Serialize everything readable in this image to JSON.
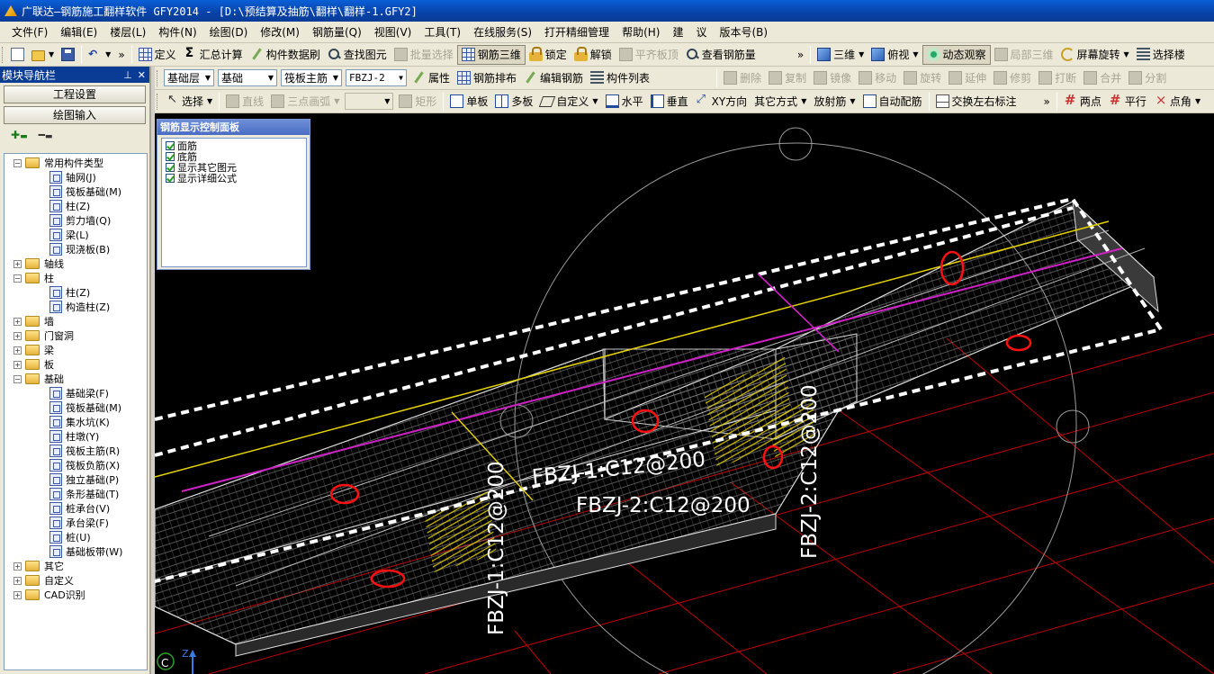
{
  "window": {
    "title": "广联达—钢筋施工翻样软件 GFY2014 - [D:\\预结算及抽筋\\翻样\\翻样-1.GFY2]"
  },
  "menu": [
    "文件(F)",
    "编辑(E)",
    "楼层(L)",
    "构件(N)",
    "绘图(D)",
    "修改(M)",
    "钢筋量(Q)",
    "视图(V)",
    "工具(T)",
    "在线服务(S)",
    "打开精细管理",
    "帮助(H)",
    "建",
    "议",
    "版本号(B)"
  ],
  "toolbar1": {
    "define": "定义",
    "summary": "汇总计算",
    "brush": "构件数据刷",
    "find": "查找图元",
    "batch_select": "批量选择",
    "rebar3d": "钢筋三维",
    "lock": "锁定",
    "unlock": "解锁",
    "flat_top": "平齐板顶",
    "view_qty": "查看钢筋量",
    "view3d": "三维",
    "top_view": "俯视",
    "dynamic": "动态观察",
    "local3d": "局部三维",
    "screen_rotate": "屏幕旋转",
    "select_layer": "选择楼"
  },
  "toolbar2": {
    "floor": "基础层",
    "category": "基础",
    "element_type": "筏板主筋",
    "element_name": "FBZJ-2",
    "property": "属性",
    "rebar_layout": "钢筋排布",
    "edit_rebar": "编辑钢筋",
    "element_list": "构件列表",
    "delete": "删除",
    "copy": "复制",
    "mirror": "镜像",
    "move": "移动",
    "rotate": "旋转",
    "extend": "延伸",
    "trim": "修剪",
    "break": "打断",
    "merge": "合并",
    "split": "分割"
  },
  "toolbar3": {
    "select": "选择",
    "line": "直线",
    "arc3": "三点画弧",
    "rect": "矩形",
    "single_board": "单板",
    "multi_board": "多板",
    "custom": "自定义",
    "horizontal": "水平",
    "vertical": "垂直",
    "xy_dir": "XY方向",
    "other_mode": "其它方式",
    "radial": "放射筋",
    "auto_rebar": "自动配筋",
    "swap_label": "交换左右标注",
    "two_points": "两点",
    "parallel": "平行",
    "point_angle": "点角"
  },
  "nav": {
    "title": "模块导航栏",
    "project_settings": "工程设置",
    "drawing_input": "绘图输入",
    "tree": [
      {
        "label": "常用构件类型",
        "level": 0,
        "expanded": true,
        "folder": true
      },
      {
        "label": "轴网(J)",
        "level": 1
      },
      {
        "label": "筏板基础(M)",
        "level": 1
      },
      {
        "label": "柱(Z)",
        "level": 1
      },
      {
        "label": "剪力墙(Q)",
        "level": 1
      },
      {
        "label": "梁(L)",
        "level": 1
      },
      {
        "label": "现浇板(B)",
        "level": 1
      },
      {
        "label": "轴线",
        "level": 0,
        "expanded": false,
        "folder": true
      },
      {
        "label": "柱",
        "level": 0,
        "expanded": true,
        "folder": true
      },
      {
        "label": "柱(Z)",
        "level": 1
      },
      {
        "label": "构造柱(Z)",
        "level": 1
      },
      {
        "label": "墙",
        "level": 0,
        "expanded": false,
        "folder": true
      },
      {
        "label": "门窗洞",
        "level": 0,
        "expanded": false,
        "folder": true
      },
      {
        "label": "梁",
        "level": 0,
        "expanded": false,
        "folder": true
      },
      {
        "label": "板",
        "level": 0,
        "expanded": false,
        "folder": true
      },
      {
        "label": "基础",
        "level": 0,
        "expanded": true,
        "folder": true
      },
      {
        "label": "基础梁(F)",
        "level": 1
      },
      {
        "label": "筏板基础(M)",
        "level": 1
      },
      {
        "label": "集水坑(K)",
        "level": 1
      },
      {
        "label": "柱墩(Y)",
        "level": 1
      },
      {
        "label": "筏板主筋(R)",
        "level": 1
      },
      {
        "label": "筏板负筋(X)",
        "level": 1
      },
      {
        "label": "独立基础(P)",
        "level": 1
      },
      {
        "label": "条形基础(T)",
        "level": 1
      },
      {
        "label": "桩承台(V)",
        "level": 1
      },
      {
        "label": "承台梁(F)",
        "level": 1
      },
      {
        "label": "桩(U)",
        "level": 1
      },
      {
        "label": "基础板带(W)",
        "level": 1
      },
      {
        "label": "其它",
        "level": 0,
        "expanded": false,
        "folder": true
      },
      {
        "label": "自定义",
        "level": 0,
        "expanded": false,
        "folder": true
      },
      {
        "label": "CAD识别",
        "level": 0,
        "expanded": false,
        "folder": true
      }
    ]
  },
  "rebar_panel": {
    "title": "钢筋显示控制面板",
    "items": [
      {
        "label": "面筋",
        "checked": true
      },
      {
        "label": "底筋",
        "checked": true
      },
      {
        "label": "显示其它图元",
        "checked": true
      },
      {
        "label": "显示详细公式",
        "checked": true
      }
    ]
  },
  "canvas": {
    "labels": {
      "label1": "FBZJ-1:C12@200",
      "label2": "FBZJ-2:C12@200",
      "label3": "FBZJ-2:C12@200",
      "label4": "FBZJ-1:C12@200"
    },
    "axis_z": "Z",
    "axis_c": "C"
  },
  "colors": {
    "rebar_top": "#e8d400",
    "rebar_magenta": "#d020c8",
    "grid_red": "#c00000",
    "mark_red": "#ff1010"
  }
}
